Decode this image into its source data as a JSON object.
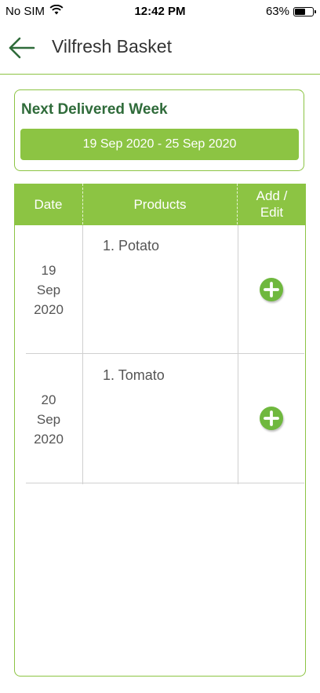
{
  "status_bar": {
    "carrier": "No SIM",
    "time": "12:42 PM",
    "battery": "63%",
    "battery_level": 0.63
  },
  "header": {
    "title": "Vilfresh Basket",
    "back_icon": "arrow-left-icon"
  },
  "week": {
    "title": "Next Delivered Week",
    "range": "19 Sep 2020 - 25 Sep 2020"
  },
  "table": {
    "headers": {
      "date": "Date",
      "products": "Products",
      "add_line1": "Add /",
      "add_line2": "Edit"
    },
    "rows": [
      {
        "day": "19",
        "month": "Sep",
        "year": "2020",
        "products": [
          "1. Potato"
        ],
        "action_icon": "plus-circle-icon"
      },
      {
        "day": "20",
        "month": "Sep",
        "year": "2020",
        "products": [
          "1. Tomato"
        ],
        "action_icon": "plus-circle-icon"
      }
    ]
  },
  "colors": {
    "accent": "#8cc443",
    "title_green": "#2f6b3a",
    "add_button": "#6fb83e"
  }
}
